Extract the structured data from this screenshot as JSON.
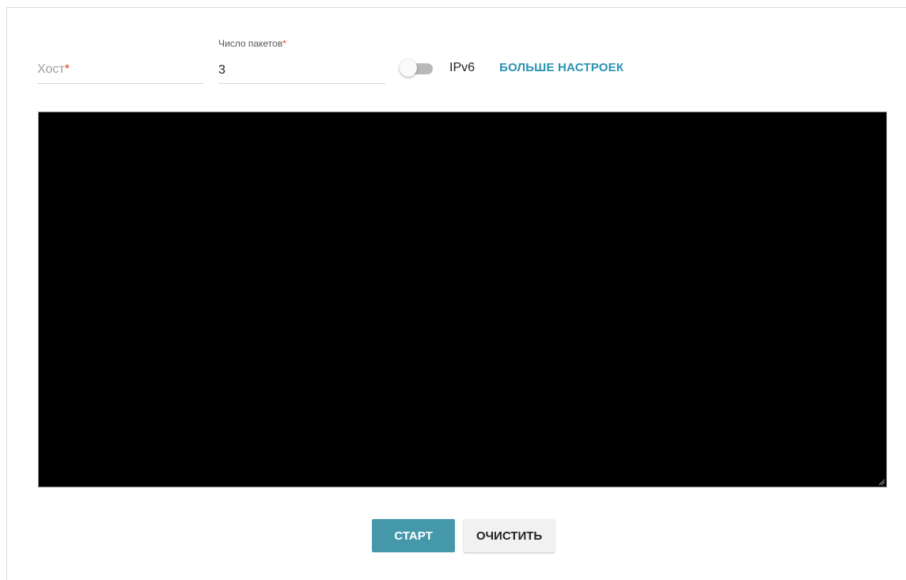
{
  "form": {
    "host": {
      "placeholder": "Хост",
      "required_mark": "*"
    },
    "packet_count": {
      "label": "Число пакетов",
      "required_mark": "*",
      "value": "3"
    },
    "ipv6_toggle": {
      "label": "IPv6",
      "enabled": false
    },
    "more_settings_label": "БОЛЬШЕ НАСТРОЕК"
  },
  "console": {
    "output": ""
  },
  "actions": {
    "start_label": "СТАРТ",
    "clear_label": "ОЧИСТИТЬ"
  },
  "colors": {
    "accent": "#2a93b3",
    "start_button": "#4598a9",
    "required": "#e0401a",
    "console_bg": "#000000"
  }
}
